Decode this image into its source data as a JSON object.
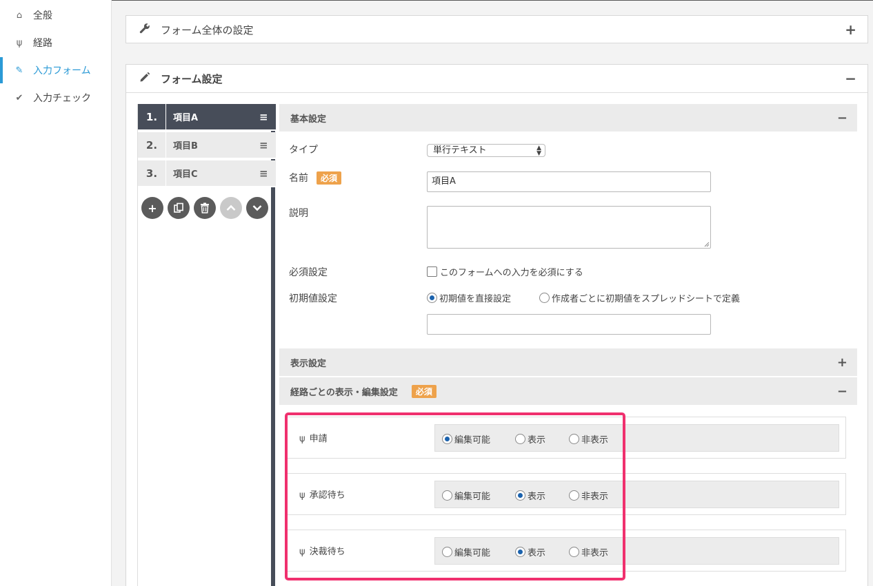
{
  "sidebar": {
    "items": [
      {
        "label": "全般",
        "icon": "home-icon",
        "glyph": "⌂"
      },
      {
        "label": "経路",
        "icon": "route-icon",
        "glyph": "ψ"
      },
      {
        "label": "入力フォーム",
        "icon": "pencil-icon",
        "glyph": "✎"
      },
      {
        "label": "入力チェック",
        "icon": "check-icon",
        "glyph": "✔"
      }
    ],
    "active_index": 2
  },
  "panel_form_overall": {
    "title": "フォーム全体の設定",
    "icon": "wrench-icon",
    "toggle": "+"
  },
  "panel_form_settings": {
    "title": "フォーム設定",
    "icon": "pencil-icon",
    "toggle": "−"
  },
  "items": [
    {
      "num": "1.",
      "name": "項目A",
      "handle": "≡"
    },
    {
      "num": "2.",
      "name": "項目B",
      "handle": "≡"
    },
    {
      "num": "3.",
      "name": "項目C",
      "handle": "≡"
    }
  ],
  "tools": [
    "add-icon",
    "copy-icon",
    "trash-icon",
    "up-icon",
    "down-icon"
  ],
  "basic": {
    "title": "基本設定",
    "toggle": "−",
    "type_label": "タイプ",
    "type_value": "単行テキスト",
    "name_label": "名前",
    "required_badge": "必須",
    "name_value": "項目A",
    "desc_label": "説明",
    "desc_value": "",
    "required_label": "必須設定",
    "required_checkbox_label": "このフォームへの入力を必須にする",
    "required_checked": false,
    "initial_label": "初期値設定",
    "initial_opt1": "初期値を直接設定",
    "initial_opt2": "作成者ごとに初期値をスプレッドシートで定義",
    "initial_selected": 1,
    "initial_value": ""
  },
  "display": {
    "title": "表示設定",
    "toggle": "+"
  },
  "route_display": {
    "title": "経路ごとの表示・編集設定",
    "badge": "必須",
    "toggle": "−",
    "options": [
      "編集可能",
      "表示",
      "非表示"
    ],
    "routes": [
      {
        "name": "申請",
        "selected": 0
      },
      {
        "name": "承認待ち",
        "selected": 1
      },
      {
        "name": "決裁待ち",
        "selected": 1
      }
    ]
  },
  "colors": {
    "accent": "#2b9ad6",
    "dark": "#474d59",
    "badge": "#eea24b",
    "highlight": "#f0306e"
  }
}
